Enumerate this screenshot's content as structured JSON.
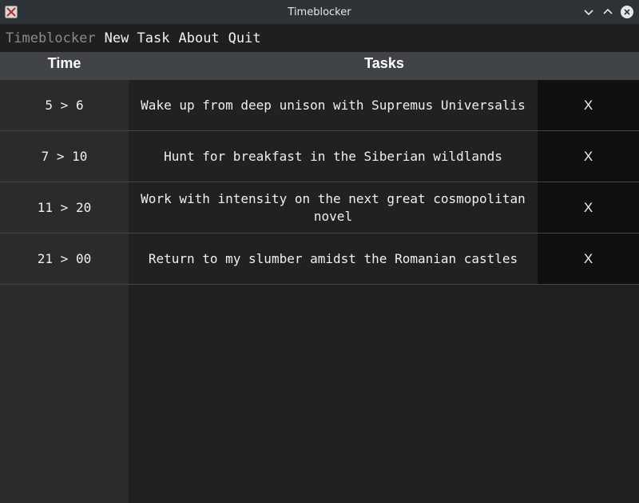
{
  "window": {
    "title": "Timeblocker",
    "icon": "app-x-icon",
    "controls": [
      "minimize-icon",
      "maximize-icon",
      "close-icon"
    ]
  },
  "menu": {
    "brand": "Timeblocker",
    "items": [
      "New Task",
      "About",
      "Quit"
    ]
  },
  "table": {
    "headers": {
      "time": "Time",
      "tasks": "Tasks"
    },
    "rows": [
      {
        "time": "5 > 6",
        "task": "Wake up from deep unison with Supremus Universalis",
        "delete": "X"
      },
      {
        "time": "7 > 10",
        "task": "Hunt for breakfast in the Siberian wildlands",
        "delete": "X"
      },
      {
        "time": "11 > 20",
        "task": "Work with intensity on the next great cosmopolitan novel",
        "delete": "X"
      },
      {
        "time": "21 > 00",
        "task": "Return to my slumber amidst the Romanian castles",
        "delete": "X"
      }
    ]
  },
  "colors": {
    "titlebar": "#2e3338",
    "header": "#404447",
    "time_column": "#2b2b2b",
    "task_column": "#212121",
    "delete_column": "#101010"
  }
}
